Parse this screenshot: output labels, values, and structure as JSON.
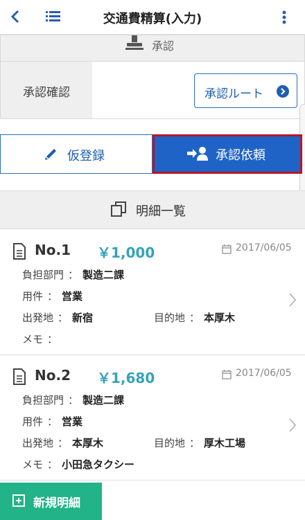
{
  "header": {
    "title": "交通費精算(入力)",
    "back_icon": "chevron-left-icon",
    "list_icon": "list-icon",
    "more_icon": "more-vertical-icon"
  },
  "approval": {
    "heading": "承認",
    "confirm_label": "承認確認",
    "route_button": "承認ルート"
  },
  "actions": {
    "draft_button": "仮登録",
    "request_button": "承認依頼"
  },
  "list": {
    "heading": "明細一覧",
    "items": [
      {
        "no": "No.1",
        "amount": "￥1,000",
        "date": "2017/06/05",
        "dept_label": "負担部門",
        "dept": "製造二課",
        "purpose_label": "用件",
        "purpose": "営業",
        "from_label": "出発地",
        "from": "新宿",
        "to_label": "目的地",
        "to": "本厚木",
        "memo_label": "メモ",
        "memo": ""
      },
      {
        "no": "No.2",
        "amount": "￥1,680",
        "date": "2017/06/05",
        "dept_label": "負担部門",
        "dept": "製造二課",
        "purpose_label": "用件",
        "purpose": "営業",
        "from_label": "出発地",
        "from": "本厚木",
        "to_label": "目的地",
        "to": "厚木工場",
        "memo_label": "メモ",
        "memo": "小田急タクシー"
      }
    ]
  },
  "footer": {
    "new_button": "新規明細"
  },
  "colors": {
    "primary": "#1f63c6",
    "accent_teal": "#35a3b9",
    "green": "#22b388",
    "highlight_border": "#b5162b"
  }
}
